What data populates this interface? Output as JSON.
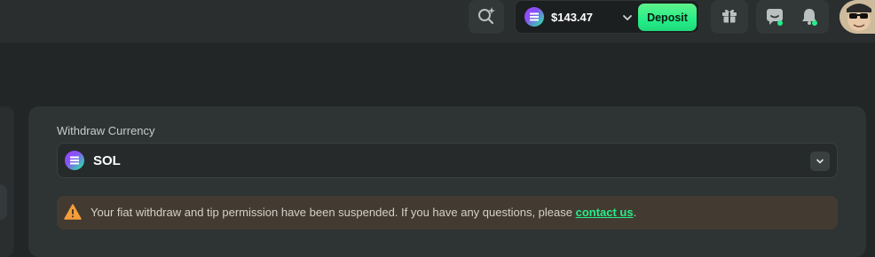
{
  "header": {
    "wallet": {
      "balance": "$143.47",
      "currency_icon": "sol-coin-icon",
      "deposit_label": "Deposit"
    }
  },
  "withdraw": {
    "currency_label": "Withdraw Currency",
    "selected_currency": "SOL",
    "notice": {
      "text": "Your fiat withdraw and tip permission have been suspended. If you have any questions, please ",
      "link_text": "contact us",
      "suffix": "."
    }
  },
  "colors": {
    "accent_green": "#24ee89",
    "notice_bg": "#433b31",
    "warning_orange": "#f59e3a"
  }
}
